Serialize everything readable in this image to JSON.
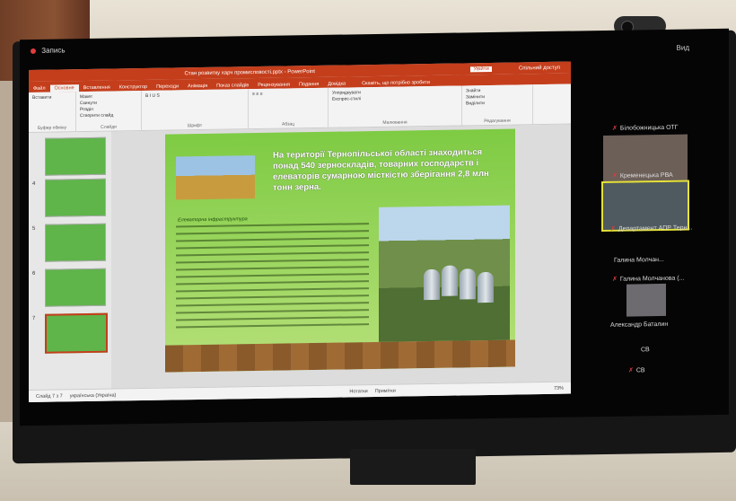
{
  "recording": "Запись",
  "exit": "Вид",
  "ppt": {
    "title": "Стан розвитку харч промисловості.pptx - PowerPoint",
    "sign_in": "Увійти",
    "share": "Спільний доступ",
    "tabs": [
      "Файл",
      "Основне",
      "Вставлення",
      "Конструктор",
      "Переходи",
      "Анімація",
      "Показ слайдів",
      "Рецензування",
      "Подання",
      "Довідка"
    ],
    "tell_me": "Скажіть, що потрібно зробити",
    "ribbon_groups": [
      {
        "label": "Буфер обміну",
        "items": [
          "Вставити"
        ]
      },
      {
        "label": "Слайди",
        "items": [
          "Макет",
          "Скинути",
          "Розділ",
          "Створити слайд"
        ]
      },
      {
        "label": "Шрифт",
        "items": [
          "B  I  U  S"
        ]
      },
      {
        "label": "Абзац",
        "items": [
          "≡ ≡ ≡"
        ]
      },
      {
        "label": "Малювання",
        "items": [
          "Упорядкувати",
          "Експрес-стилі"
        ]
      },
      {
        "label": "Редагування",
        "items": [
          "Знайти",
          "Замінити",
          "Виділити"
        ]
      }
    ],
    "slide_numbers": [
      "4",
      "5",
      "6",
      "7"
    ],
    "slide_title": "На території Тернопільської області знаходиться понад 540 зерноскладів, товарних господарств і елеваторів сумарною місткістю зберігання 2,8 млн тонн зерна.",
    "slide_subtitle": "Елеваторна інфраструктура",
    "status_left": "Слайд 7 з 7",
    "status_lang": "українська (Україна)",
    "status_notes": "Нотатки",
    "status_comments": "Примітки",
    "zoom": "73%"
  },
  "participants": [
    {
      "name": "Білобожницька ОТГ"
    },
    {
      "name": "Кременецька РВА"
    },
    {
      "name": "Департамент АПР Терн..."
    },
    {
      "name": "Галина Молчан..."
    },
    {
      "name": "Галина Молчанова (..."
    },
    {
      "name": "Александр Баталин"
    },
    {
      "name": "СВ"
    },
    {
      "name": "СВ"
    }
  ]
}
